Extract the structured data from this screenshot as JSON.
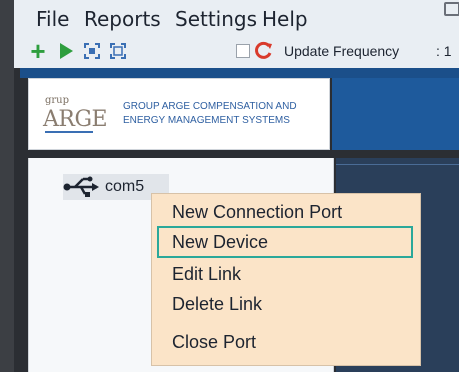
{
  "menubar": {
    "items": [
      "File",
      "Reports",
      "Settings",
      "Help"
    ]
  },
  "toolbar": {
    "icons": [
      "add-icon",
      "play-icon",
      "capture-icon",
      "frame-icon",
      "checkbox",
      "refresh-icon"
    ],
    "update_frequency_label": "Update Frequency",
    "colon_value": ": 1"
  },
  "logo": {
    "small_text": "grup",
    "big_text": "ARGE",
    "tagline": "GROUP ARGE COMPENSATION AND\nENERGY MANAGEMENT SYSTEMS"
  },
  "tree": {
    "node_label": "com5",
    "node_icon": "usb-icon"
  },
  "context_menu": {
    "items": [
      "New Connection Port",
      "New Device",
      "Edit Link",
      "Delete Link",
      "Close Port"
    ],
    "highlighted_index": 1,
    "highlight_color": "#2aa89a"
  },
  "colors": {
    "menu_bg": "#e9eef3",
    "header_blue": "#1e5a9c",
    "context_bg": "#fbe4c8",
    "accent_green": "#2e9e3e",
    "accent_red": "#d93a2b"
  }
}
